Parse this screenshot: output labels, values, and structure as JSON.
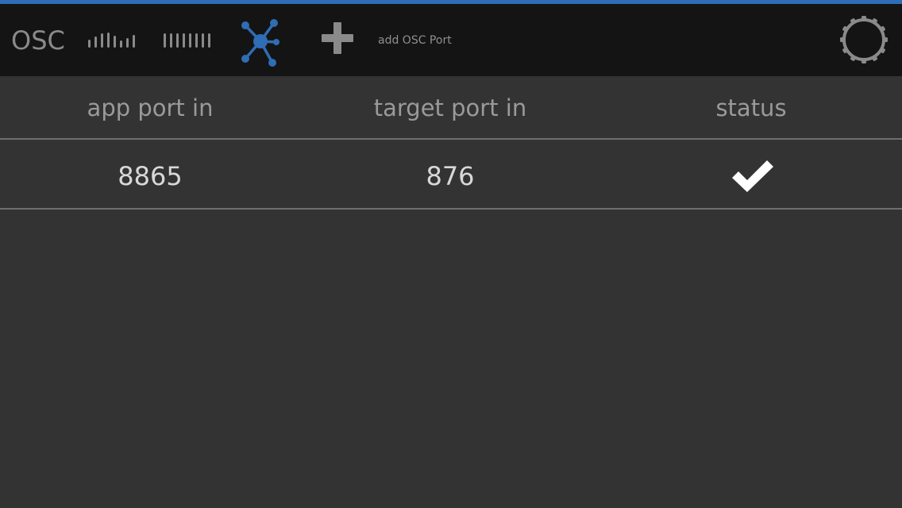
{
  "colors": {
    "accent": "#2f6db5",
    "toolbar_bg": "#141414",
    "content_bg": "#333333",
    "icon_gray": "#8a8a8a",
    "active_icon": "#2f6db5",
    "check": "#ffffff"
  },
  "toolbar": {
    "title": "OSC",
    "icons": [
      "level-bars-icon",
      "equal-bars-icon",
      "network-nodes-icon",
      "plus-icon",
      "gear-icon"
    ],
    "add_label": "add OSC Port"
  },
  "table": {
    "columns": [
      "app port in",
      "target port in",
      "status"
    ],
    "rows": [
      {
        "app_port_in": "8865",
        "target_port_in": "876",
        "status": "ok"
      }
    ]
  }
}
